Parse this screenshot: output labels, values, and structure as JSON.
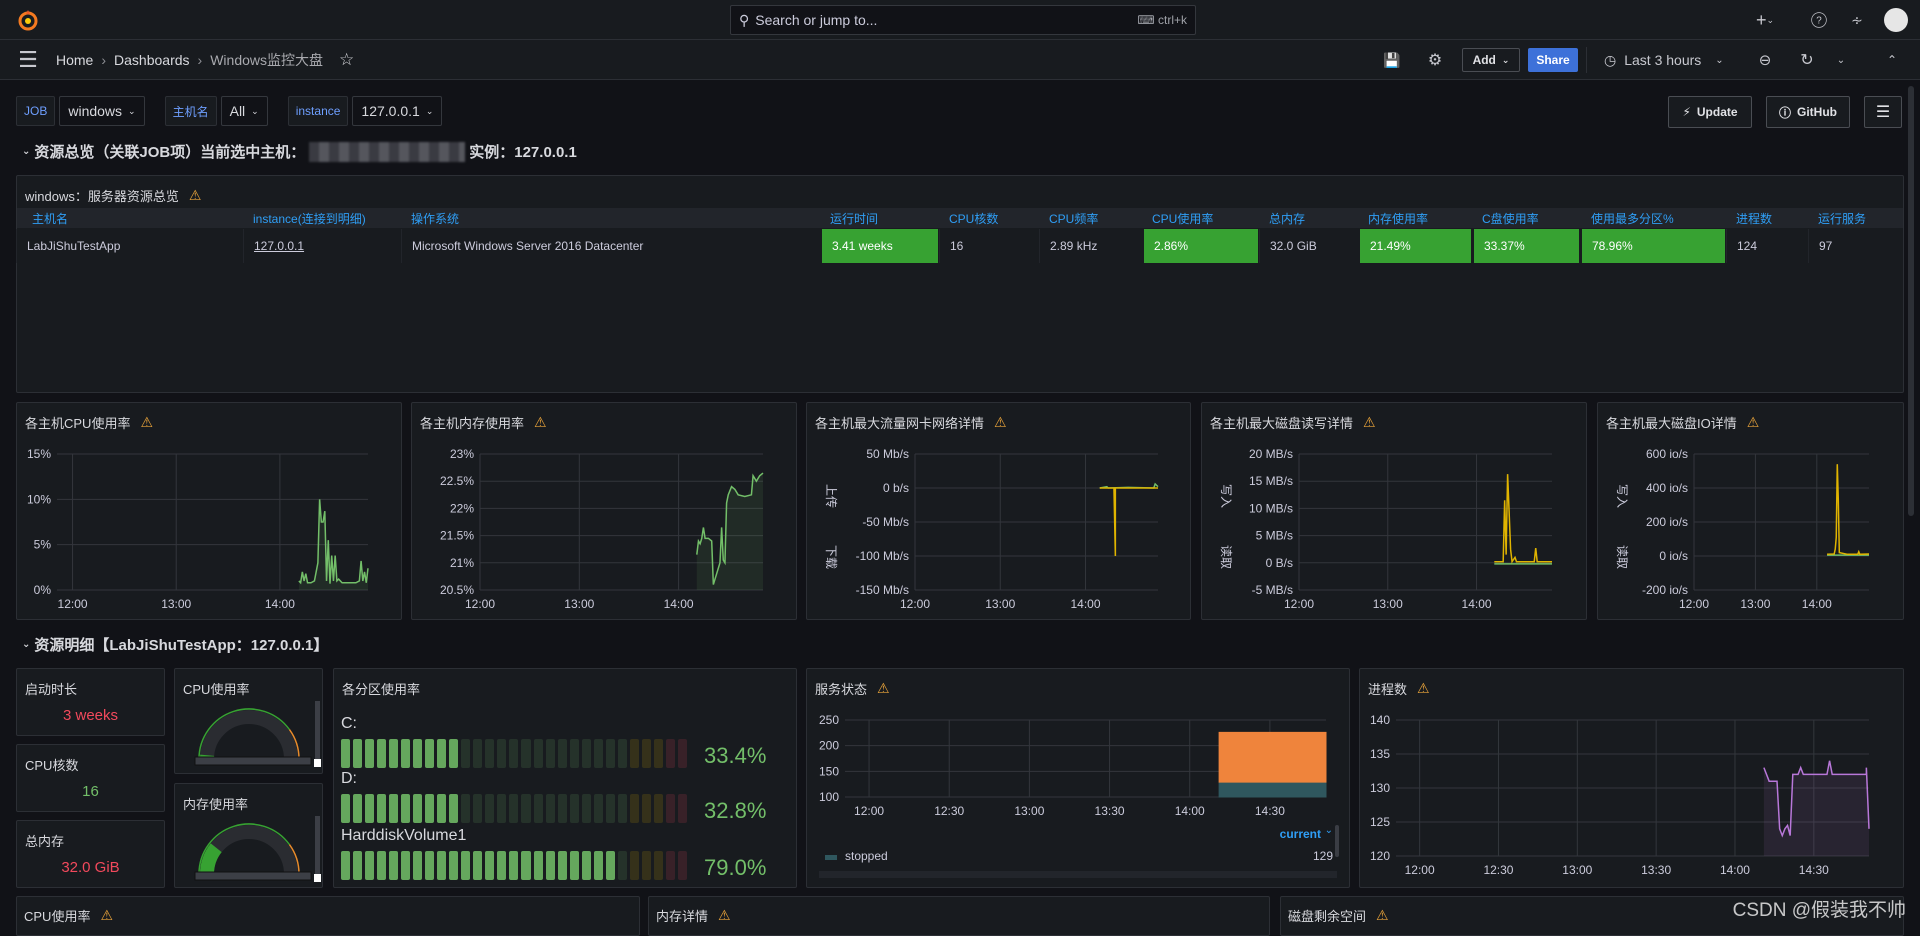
{
  "topbar": {
    "search_placeholder": "Search or jump to...",
    "search_shortcut": "ctrl+k",
    "icons": [
      "grafana-logo",
      "search-icon",
      "keyboard-icon",
      "plus-icon",
      "help-icon",
      "rss-icon",
      "avatar"
    ]
  },
  "breadcrumb": [
    "Home",
    "Dashboards",
    "Windows监控大盘"
  ],
  "toolbar": {
    "add": "Add",
    "share": "Share",
    "time_range": "Last 3 hours"
  },
  "variables": [
    {
      "label": "JOB",
      "value": "windows"
    },
    {
      "label": "主机名",
      "value": "All"
    },
    {
      "label": "instance",
      "value": "127.0.0.1"
    }
  ],
  "links": {
    "update": "Update",
    "github": "GitHub"
  },
  "row1": {
    "title": "资源总览（关联JOB项）当前选中主机：",
    "instance_label": "实例：127.0.0.1"
  },
  "table": {
    "title": "windows：服务器资源总览",
    "headers": [
      "主机名",
      "instance(连接到明细)",
      "操作系统",
      "运行时间",
      "CPU核数",
      "CPU频率",
      "CPU使用率",
      "总内存",
      "内存使用率",
      "C盘使用率",
      "使用最多分区%",
      "进程数",
      "运行服务"
    ],
    "row": [
      "LabJiShuTestApp",
      "127.0.0.1",
      "Microsoft Windows Server 2016 Datacenter",
      "3.41 weeks",
      "16",
      "2.89 kHz",
      "2.86%",
      "32.0 GiB",
      "21.49%",
      "33.37%",
      "78.96%",
      "124",
      "97"
    ],
    "green_color": "#37a232"
  },
  "row2": {
    "title": "资源明细【LabJiShuTestApp：127.0.0.1】"
  },
  "stats": [
    {
      "title": "启动时长",
      "value": "3 weeks",
      "color": "#f2495c"
    },
    {
      "title": "CPU核数",
      "value": "16",
      "color": "#73bf69"
    },
    {
      "title": "总内存",
      "value": "32.0 GiB",
      "color": "#f2495c"
    }
  ],
  "gauges": [
    {
      "title": "CPU使用率",
      "value": 2.86
    },
    {
      "title": "内存使用率",
      "value": 21.49
    }
  ],
  "partitions": {
    "title": "各分区使用率",
    "items": [
      {
        "name": "C:",
        "value": 33.4,
        "label": "33.4%"
      },
      {
        "name": "D:",
        "value": 32.8,
        "label": "32.8%"
      },
      {
        "name": "HarddiskVolume1",
        "value": 79.0,
        "label": "79.0%"
      }
    ]
  },
  "bottom_panels": [
    "CPU使用率",
    "内存详情",
    "磁盘剩余空间"
  ],
  "watermark": "CSDN @假装我不帅",
  "chart_data": [
    {
      "id": "cpu",
      "type": "line",
      "title": "各主机CPU使用率",
      "ylim": [
        0,
        15
      ],
      "yticks": [
        0,
        5,
        10,
        15
      ],
      "ytick_labels": [
        "0%",
        "5%",
        "10%",
        "15%"
      ],
      "xlim": [
        "11:51",
        "14:51"
      ],
      "xticks": [
        "12:00",
        "13:00",
        "14:00"
      ],
      "grid": true,
      "series": [
        {
          "color": "#73bf69",
          "fill": true,
          "points": [
            [
              "14:11",
              1
            ],
            [
              "14:12",
              0.8
            ],
            [
              "14:13",
              2
            ],
            [
              "14:14",
              1
            ],
            [
              "14:15",
              1.8
            ],
            [
              "14:16",
              0.8
            ],
            [
              "14:18",
              0.8
            ],
            [
              "14:20",
              1
            ],
            [
              "14:22",
              3
            ],
            [
              "14:23",
              10
            ],
            [
              "14:24",
              7.5
            ],
            [
              "14:25",
              7.5
            ],
            [
              "14:26",
              8.7
            ],
            [
              "14:27",
              1
            ],
            [
              "14:28",
              5.5
            ],
            [
              "14:29",
              0.7
            ],
            [
              "14:30",
              3.8
            ],
            [
              "14:31",
              1
            ],
            [
              "14:32",
              3.8
            ],
            [
              "14:33",
              1
            ],
            [
              "14:34",
              1.2
            ],
            [
              "14:36",
              0.8
            ],
            [
              "14:40",
              0.8
            ],
            [
              "14:44",
              0.8
            ],
            [
              "14:46",
              1
            ],
            [
              "14:47",
              3.2
            ],
            [
              "14:48",
              1
            ],
            [
              "14:49",
              2
            ],
            [
              "14:50",
              0.8
            ],
            [
              "14:51",
              2.4
            ]
          ]
        }
      ]
    },
    {
      "id": "mem",
      "type": "line",
      "title": "各主机内存使用率",
      "ylim": [
        20.5,
        23
      ],
      "yticks": [
        20.5,
        21,
        21.5,
        22,
        22.5,
        23
      ],
      "ytick_labels": [
        "20.5%",
        "21%",
        "21.5%",
        "22%",
        "22.5%",
        "23%"
      ],
      "xlim": [
        "12:00",
        "14:51"
      ],
      "xticks": [
        "12:00",
        "13:00",
        "14:00"
      ],
      "grid": true,
      "series": [
        {
          "color": "#73bf69",
          "fill": true,
          "points": [
            [
              "14:11",
              21.15
            ],
            [
              "14:12",
              21.4
            ],
            [
              "14:13",
              21.35
            ],
            [
              "14:14",
              21.45
            ],
            [
              "14:15",
              21.65
            ],
            [
              "14:16",
              21.45
            ],
            [
              "14:18",
              21.45
            ],
            [
              "14:20",
              21.4
            ],
            [
              "14:21",
              20.6
            ],
            [
              "14:23",
              20.8
            ],
            [
              "14:25",
              21.0
            ],
            [
              "14:26",
              21.65
            ],
            [
              "14:27",
              21.05
            ],
            [
              "14:28",
              21.0
            ],
            [
              "14:29",
              22.1
            ],
            [
              "14:30",
              22.25
            ],
            [
              "14:32",
              22.4
            ],
            [
              "14:34",
              22.35
            ],
            [
              "14:36",
              22.25
            ],
            [
              "14:40",
              22.22
            ],
            [
              "14:44",
              22.25
            ],
            [
              "14:45",
              22.6
            ],
            [
              "14:47",
              22.5
            ],
            [
              "14:49",
              22.6
            ],
            [
              "14:51",
              22.65
            ]
          ]
        }
      ]
    },
    {
      "id": "net",
      "type": "line",
      "title": "各主机最大流量网卡网络详情",
      "ylabel_top": "上传",
      "ylabel_bottom": "下载",
      "ylim": [
        -150,
        50
      ],
      "yticks": [
        -150,
        -100,
        -50,
        0,
        50
      ],
      "ytick_labels": [
        "-150 Mb/s",
        "-100 Mb/s",
        "-50 Mb/s",
        "0 b/s",
        "50 Mb/s"
      ],
      "xlim": [
        "12:00",
        "14:51"
      ],
      "xticks": [
        "12:00",
        "13:00",
        "14:00"
      ],
      "grid": true,
      "series": [
        {
          "color": "#73bf69",
          "fill": false,
          "points": [
            [
              "14:10",
              0
            ],
            [
              "14:15",
              2
            ],
            [
              "14:16",
              0
            ],
            [
              "14:30",
              1
            ],
            [
              "14:48",
              0
            ],
            [
              "14:49",
              6
            ],
            [
              "14:51",
              2
            ]
          ]
        },
        {
          "color": "#e0b400",
          "fill": false,
          "points": [
            [
              "14:10",
              0
            ],
            [
              "14:20",
              0
            ],
            [
              "14:21",
              -100
            ],
            [
              "14:21",
              0
            ],
            [
              "14:51",
              0
            ]
          ]
        }
      ]
    },
    {
      "id": "disk",
      "type": "line",
      "title": "各主机最大磁盘读写详情",
      "ylabel_top": "写入",
      "ylabel_bottom": "读取",
      "ylim": [
        -5,
        20
      ],
      "yticks": [
        -5,
        0,
        5,
        10,
        15,
        20
      ],
      "ytick_labels": [
        "-5 MB/s",
        "0 B/s",
        "5 MB/s",
        "10 MB/s",
        "15 MB/s",
        "20 MB/s"
      ],
      "xlim": [
        "12:00",
        "14:51"
      ],
      "xticks": [
        "12:00",
        "13:00",
        "14:00"
      ],
      "grid": true,
      "series": [
        {
          "color": "#73bf69",
          "fill": false,
          "points": [
            [
              "14:12",
              -0.2
            ],
            [
              "14:51",
              -0.2
            ]
          ]
        },
        {
          "color": "#e0b400",
          "fill": false,
          "points": [
            [
              "14:12",
              0.2
            ],
            [
              "14:18",
              0.2
            ],
            [
              "14:19",
              11.5
            ],
            [
              "14:20",
              1.5
            ],
            [
              "14:21",
              16.3
            ],
            [
              "14:22",
              9.5
            ],
            [
              "14:23",
              2.5
            ],
            [
              "14:24",
              0.2
            ],
            [
              "14:26",
              1
            ],
            [
              "14:27",
              0.2
            ],
            [
              "14:39",
              0.2
            ],
            [
              "14:40",
              2.7
            ],
            [
              "14:41",
              0.2
            ],
            [
              "14:51",
              0.2
            ]
          ]
        }
      ]
    },
    {
      "id": "io",
      "type": "line",
      "title": "各主机最大磁盘IO详情",
      "ylabel_top": "写入",
      "ylabel_bottom": "读取",
      "ylim": [
        -200,
        600
      ],
      "yticks": [
        -200,
        0,
        200,
        400,
        600
      ],
      "ytick_labels": [
        "-200 io/s",
        "0 io/s",
        "200 io/s",
        "400 io/s",
        "600 io/s"
      ],
      "xlim": [
        "12:00",
        "14:51"
      ],
      "xticks": [
        "12:00",
        "13:00",
        "14:00"
      ],
      "grid": true,
      "series": [
        {
          "color": "#73bf69",
          "fill": false,
          "points": [
            [
              "14:10",
              5
            ],
            [
              "14:51",
              5
            ]
          ]
        },
        {
          "color": "#e0b400",
          "fill": false,
          "points": [
            [
              "14:10",
              10
            ],
            [
              "14:17",
              12
            ],
            [
              "14:18",
              40
            ],
            [
              "14:19",
              110
            ],
            [
              "14:20",
              540
            ],
            [
              "14:21",
              330
            ],
            [
              "14:22",
              20
            ],
            [
              "14:30",
              10
            ],
            [
              "14:40",
              10
            ],
            [
              "14:41",
              25
            ],
            [
              "14:42",
              10
            ],
            [
              "14:51",
              12
            ]
          ]
        }
      ]
    },
    {
      "id": "svc",
      "type": "area",
      "title": "服务状态",
      "ylim": [
        100,
        250
      ],
      "yticks": [
        100,
        150,
        200,
        250
      ],
      "ytick_labels": [
        "100",
        "150",
        "200",
        "250"
      ],
      "xlim": [
        "11:51",
        "14:51"
      ],
      "xticks": [
        "12:00",
        "12:30",
        "13:00",
        "13:30",
        "14:00",
        "14:30"
      ],
      "grid": true,
      "stacked": true,
      "legend": {
        "header": "current",
        "items": [
          {
            "name": "stopped",
            "value": "129",
            "color": "#2f575e"
          }
        ]
      },
      "series": [
        {
          "name": "stopped",
          "color": "#2f575e",
          "points": [
            [
              "14:11",
              129
            ],
            [
              "14:51",
              129
            ]
          ]
        },
        {
          "color": "#ef843c",
          "points": [
            [
              "14:11",
              97
            ],
            [
              "14:51",
              97
            ]
          ]
        }
      ]
    },
    {
      "id": "proc",
      "type": "line",
      "title": "进程数",
      "ylim": [
        120,
        140
      ],
      "yticks": [
        120,
        125,
        130,
        135,
        140
      ],
      "ytick_labels": [
        "120",
        "125",
        "130",
        "135",
        "140"
      ],
      "xlim": [
        "11:51",
        "14:51"
      ],
      "xticks": [
        "12:00",
        "12:30",
        "13:00",
        "13:30",
        "14:00",
        "14:30"
      ],
      "grid": true,
      "series": [
        {
          "color": "#b877d9",
          "fill": true,
          "points": [
            [
              "14:11",
              133
            ],
            [
              "14:12",
              132
            ],
            [
              "14:13",
              131
            ],
            [
              "14:16",
              131
            ],
            [
              "14:17",
              124
            ],
            [
              "14:18",
              123
            ],
            [
              "14:19",
              124
            ],
            [
              "14:20",
              124.5
            ],
            [
              "14:21",
              123
            ],
            [
              "14:22",
              132
            ],
            [
              "14:24",
              132
            ],
            [
              "14:25",
              133
            ],
            [
              "14:26",
              132
            ],
            [
              "14:35",
              132
            ],
            [
              "14:36",
              134
            ],
            [
              "14:37",
              132
            ],
            [
              "14:50",
              132
            ],
            [
              "14:50",
              133
            ],
            [
              "14:51",
              124
            ]
          ]
        }
      ]
    }
  ]
}
